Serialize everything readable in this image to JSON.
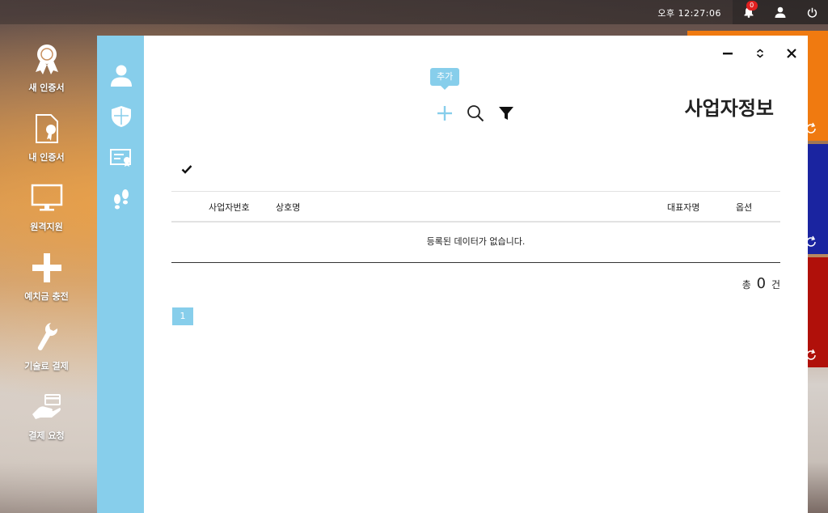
{
  "topbar": {
    "clock": "오후 12:27:06",
    "notification_count": "0"
  },
  "desktop": [
    {
      "label": "새 인증서",
      "icon": "award-ribbon-icon"
    },
    {
      "label": "내 인증서",
      "icon": "certificate-document-icon"
    },
    {
      "label": "원격지원",
      "icon": "monitor-icon"
    },
    {
      "label": "예치금 충전",
      "icon": "plus-icon"
    },
    {
      "label": "기술료 결제",
      "icon": "wrench-icon"
    },
    {
      "label": "결제 요청",
      "icon": "hand-card-icon"
    }
  ],
  "tiles": {
    "colors": [
      "#f07a10",
      "#1a24a0",
      "#b0100a"
    ]
  },
  "window": {
    "title": "사업자정보",
    "add_tooltip": "추가",
    "table": {
      "columns": [
        "사업자번호",
        "상호명",
        "대표자명",
        "옵션"
      ],
      "empty_message": "등록된 데이터가 없습니다."
    },
    "total": {
      "prefix": "총",
      "count": "0",
      "suffix": "건"
    },
    "pagination": {
      "current": "1"
    }
  },
  "colors": {
    "accent": "#87ceeb"
  }
}
